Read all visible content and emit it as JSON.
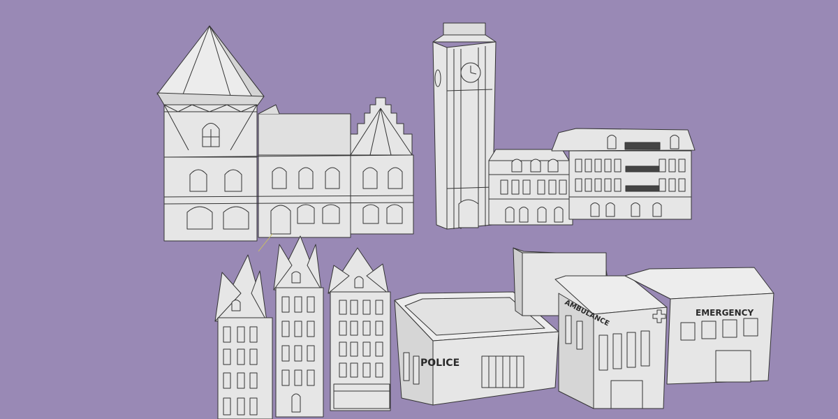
{
  "scene": {
    "background": "#9989b5",
    "model_fill": "#e6e6e6",
    "model_shade": "#cfcfcf",
    "line_color": "#333333"
  },
  "signs": {
    "police": "POLICE",
    "ambulance": "AMBULANCE",
    "emergency": "EMERGENCY"
  }
}
